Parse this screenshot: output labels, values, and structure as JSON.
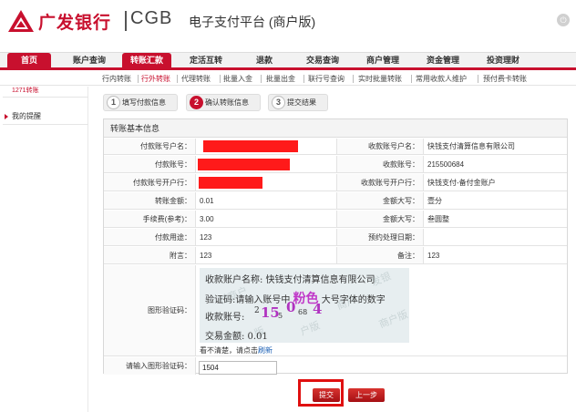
{
  "header": {
    "bank_name": "广发银行",
    "bank_en": "CGB",
    "platform_title": "电子支付平台 (商户版)",
    "exit_icon": "power-icon",
    "brand_color": "#c8102e"
  },
  "nav": {
    "items": [
      "首页",
      "账户查询",
      "转账汇款",
      "定活互转",
      "退款",
      "交易查询",
      "商户管理",
      "资金管理",
      "投资理财"
    ],
    "active": "转账汇款"
  },
  "subnav": {
    "items": [
      "行内转账",
      "行外转账",
      "代理转账",
      "批量入金",
      "批量出金",
      "联行号查询",
      "实时批量转账",
      "常用收款人维护",
      "预付费卡转账"
    ],
    "active": "行外转账"
  },
  "sidebar": {
    "items": [
      "1271转账",
      "我的提醒"
    ]
  },
  "steps": [
    {
      "num": "1",
      "label": "填写付款信息"
    },
    {
      "num": "2",
      "label": "确认转账信息"
    },
    {
      "num": "3",
      "label": "提交结果"
    }
  ],
  "form": {
    "title": "转账基本信息",
    "rows": [
      {
        "l1": "付款账号户名：",
        "v1": "",
        "l2": "收款账号户名：",
        "v2": "快钱支付清算信息有限公司"
      },
      {
        "l1": "付款账号：",
        "v1": "",
        "l2": "收款账号：",
        "v2": "215500684"
      },
      {
        "l1": "付款账号开户行：",
        "v1": "",
        "l2": "收款账号开户行：",
        "v2": "快钱支付-备付金账户"
      },
      {
        "l1": "转账金额：",
        "v1": "0.01",
        "l2": "金额大写：",
        "v2": "壹分"
      },
      {
        "l1": "手续费(参考)：",
        "v1": "3.00",
        "l2": "金额大写：",
        "v2": "叁圆整"
      },
      {
        "l1": "付款用途：",
        "v1": "123",
        "l2": "预约处理日期：",
        "v2": ""
      },
      {
        "l1": "附言：",
        "v1": "123",
        "l2": "备注：",
        "v2": "123"
      }
    ],
    "captcha_label": "图形验证码：",
    "captcha": {
      "line1": "收款账户名称:   快钱支付清算信息有限公司",
      "line2_prefix": "验证码:请输入账号中",
      "line2_emph": "粉色",
      "line2_suffix": "大号字体的数字",
      "line3_label": "收款账号:",
      "line3_pre": "2",
      "code": [
        "15",
        "0",
        "4"
      ],
      "line3_mid": "5",
      "line3_mid2": "68",
      "line4": "交易金额:     0.01",
      "watermark": [
        "发银",
        "商户",
        "商户版",
        "付商户",
        "户版",
        "版"
      ]
    },
    "refresh_prefix": "看不清楚，请点击",
    "refresh_link": "刷新",
    "code_input_label": "请输入图形验证码：",
    "code_input_value": "1504"
  },
  "buttons": {
    "submit": "提交",
    "prev": "上一步"
  }
}
